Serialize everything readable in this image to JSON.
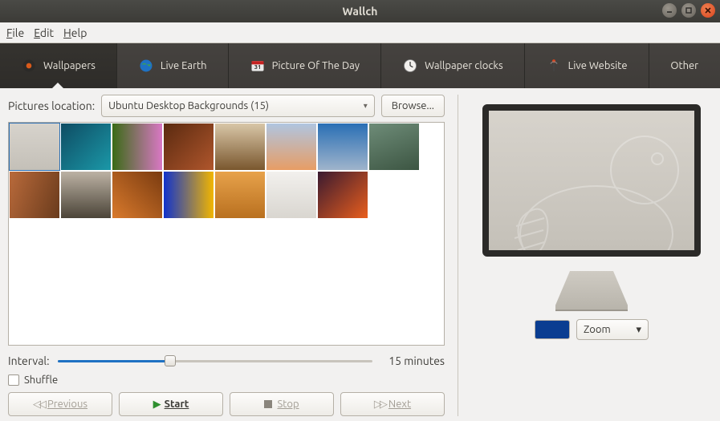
{
  "window": {
    "title": "Wallch"
  },
  "menubar": {
    "file": "File",
    "edit": "Edit",
    "help": "Help"
  },
  "tabs": {
    "wallpapers": "Wallpapers",
    "live_earth": "Live Earth",
    "potd": "Picture Of The Day",
    "wallpaper_clocks": "Wallpaper clocks",
    "live_website": "Live Website",
    "other": "Other"
  },
  "location": {
    "label": "Pictures location:",
    "selected": "Ubuntu Desktop Backgrounds (15)",
    "browse": "Browse..."
  },
  "thumbnails": [
    {
      "gradient": "linear-gradient(to bottom,#d7d3cc,#c4c0b8)",
      "selected": true
    },
    {
      "gradient": "linear-gradient(135deg,#0e4c63,#1b98a8)"
    },
    {
      "gradient": "linear-gradient(90deg,#3a6b15,#d978c4)"
    },
    {
      "gradient": "linear-gradient(135deg,#5a2a10,#b0562c)"
    },
    {
      "gradient": "linear-gradient(180deg,#d8c6a7,#7a572e)"
    },
    {
      "gradient": "linear-gradient(180deg,#b0c5e0,#e79d65)"
    },
    {
      "gradient": "linear-gradient(180deg,#2a6fb5,#9fb4cb)"
    },
    {
      "gradient": "linear-gradient(160deg,#6e8c78,#3c5542)"
    },
    {
      "gradient": "linear-gradient(110deg,#b96a3b,#6a3b1c)"
    },
    {
      "gradient": "linear-gradient(180deg,#bcb2a4,#4b4438)"
    },
    {
      "gradient": "linear-gradient(45deg,#d97a2c,#7a3b10)"
    },
    {
      "gradient": "linear-gradient(90deg,#1133cc,#f2b600)"
    },
    {
      "gradient": "linear-gradient(180deg,#e7a24b,#b9701f)"
    },
    {
      "gradient": "linear-gradient(180deg,#f2f0ed,#d9d6d0)"
    },
    {
      "gradient": "linear-gradient(135deg,#3a1a30,#e95e1d)"
    }
  ],
  "interval": {
    "label": "Interval:",
    "value_text": "15 minutes"
  },
  "shuffle": {
    "label": "Shuffle",
    "checked": false
  },
  "controls": {
    "previous": "Previous",
    "start": "Start",
    "stop": "Stop",
    "next": "Next"
  },
  "preview": {
    "caption": "Beaver_Wallpaper_Grey_4096x2304.png",
    "style_mode": "Zoom",
    "swatch_color": "#0a3d91"
  }
}
